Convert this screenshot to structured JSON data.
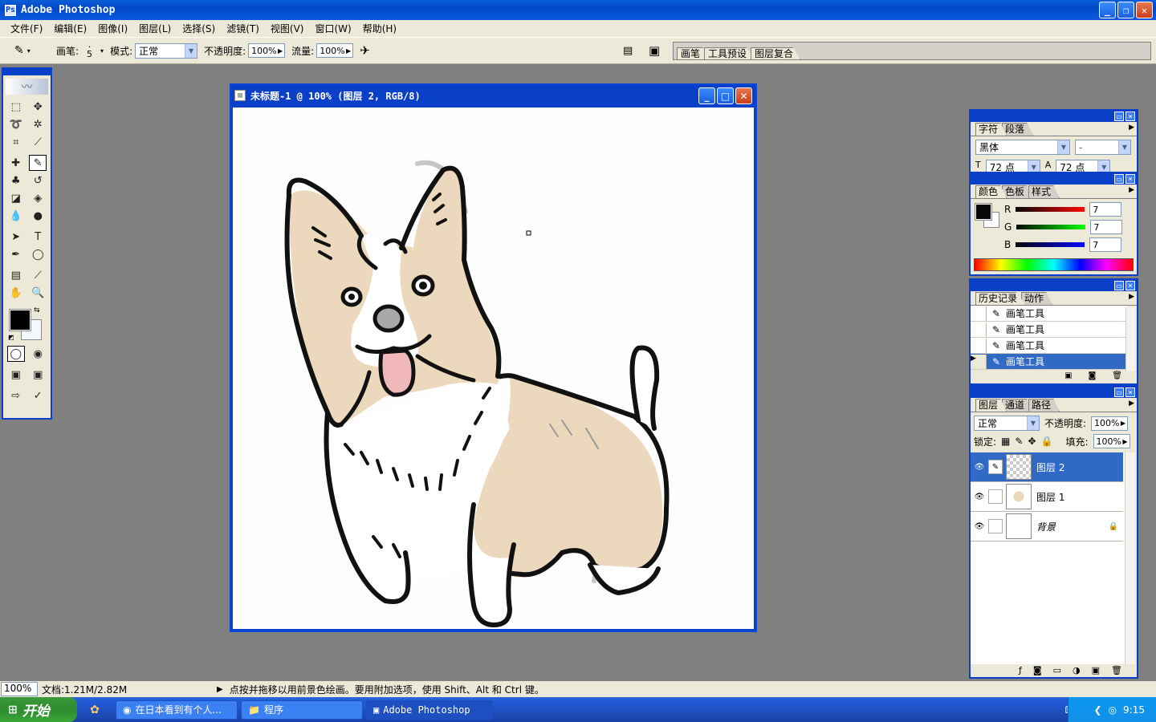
{
  "app": {
    "title": "Adobe Photoshop"
  },
  "menu": [
    "文件(F)",
    "编辑(E)",
    "图像(I)",
    "图层(L)",
    "选择(S)",
    "滤镜(T)",
    "视图(V)",
    "窗口(W)",
    "帮助(H)"
  ],
  "options": {
    "brush_label": "画笔:",
    "brush_size": "5",
    "mode_label": "模式:",
    "mode_value": "正常",
    "opacity_label": "不透明度:",
    "opacity_value": "100%",
    "flow_label": "流量:",
    "flow_value": "100%"
  },
  "palette_well": [
    "画笔",
    "工具预设",
    "图层复合"
  ],
  "document": {
    "title": "未标题-1 @ 100% (图层 2, RGB/8)"
  },
  "char_panel": {
    "tabs": [
      "字符",
      "段落"
    ],
    "font": "黑体",
    "style": "-",
    "size": "72 点",
    "leading": "72 点"
  },
  "color_panel": {
    "tabs": [
      "颜色",
      "色板",
      "样式"
    ],
    "r_label": "R",
    "g_label": "G",
    "b_label": "B",
    "r": "7",
    "g": "7",
    "b": "7",
    "fg": "#070707"
  },
  "history_panel": {
    "tabs": [
      "历史记录",
      "动作"
    ],
    "items": [
      "画笔工具",
      "画笔工具",
      "画笔工具",
      "画笔工具"
    ]
  },
  "layers_panel": {
    "tabs": [
      "图层",
      "通道",
      "路径"
    ],
    "blend": "正常",
    "opacity_label": "不透明度:",
    "opacity": "100%",
    "lock_label": "锁定:",
    "fill_label": "填充:",
    "fill": "100%",
    "layers": [
      {
        "name": "图层 2",
        "selected": true
      },
      {
        "name": "图层 1",
        "selected": false
      },
      {
        "name": "背景",
        "selected": false
      }
    ]
  },
  "status": {
    "zoom": "100%",
    "doc": "文档:1.21M/2.82M",
    "hint": "点按并拖移以用前景色绘画。要用附加选项，使用 Shift、Alt 和 Ctrl 键。"
  },
  "taskbar": {
    "start": "开始",
    "tasks": [
      "在日本看到有个人...",
      "程序",
      "Adobe Photoshop"
    ],
    "time": "9:15"
  },
  "colors": {
    "xp_blue": "#0a3fc8",
    "fur": "#ecd8bc",
    "tongue": "#f0b8b8",
    "nose": "#a8a8a8"
  }
}
